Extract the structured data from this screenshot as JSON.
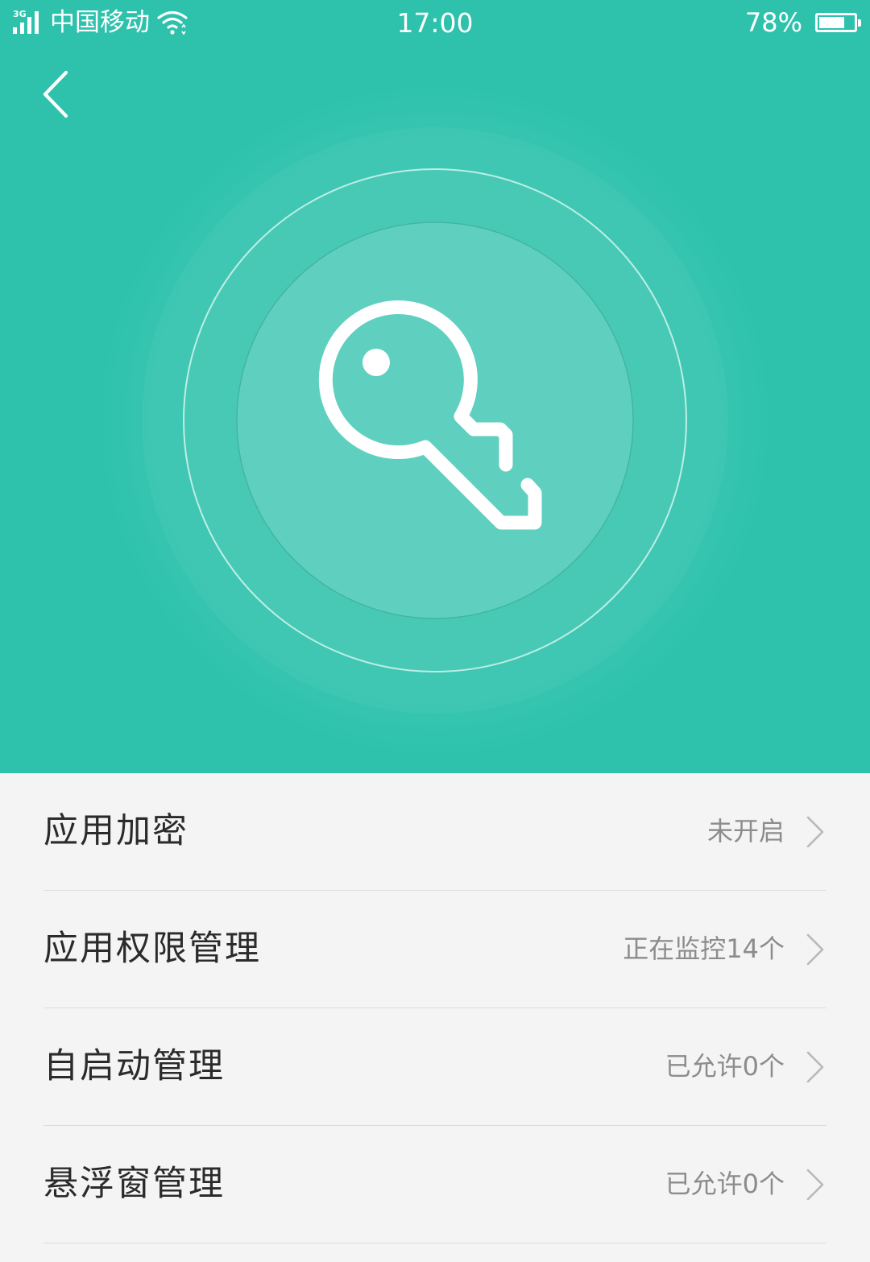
{
  "status_bar": {
    "network": "3G",
    "carrier": "中国移动",
    "time": "17:00",
    "battery_percent_label": "78%",
    "battery_level": 0.78
  },
  "header": {
    "back_icon": "chevron-left-icon",
    "hero_icon": "key-icon"
  },
  "settings": [
    {
      "label": "应用加密",
      "value": "未开启"
    },
    {
      "label": "应用权限管理",
      "value": "正在监控14个"
    },
    {
      "label": "自启动管理",
      "value": "已允许0个"
    },
    {
      "label": "悬浮窗管理",
      "value": "已允许0个"
    }
  ],
  "colors": {
    "accent": "#2ec2ad",
    "list_background": "#f4f4f4",
    "label_text": "#2b2b2b",
    "value_text": "#8c8c8c",
    "divider": "#dcdcdc"
  }
}
